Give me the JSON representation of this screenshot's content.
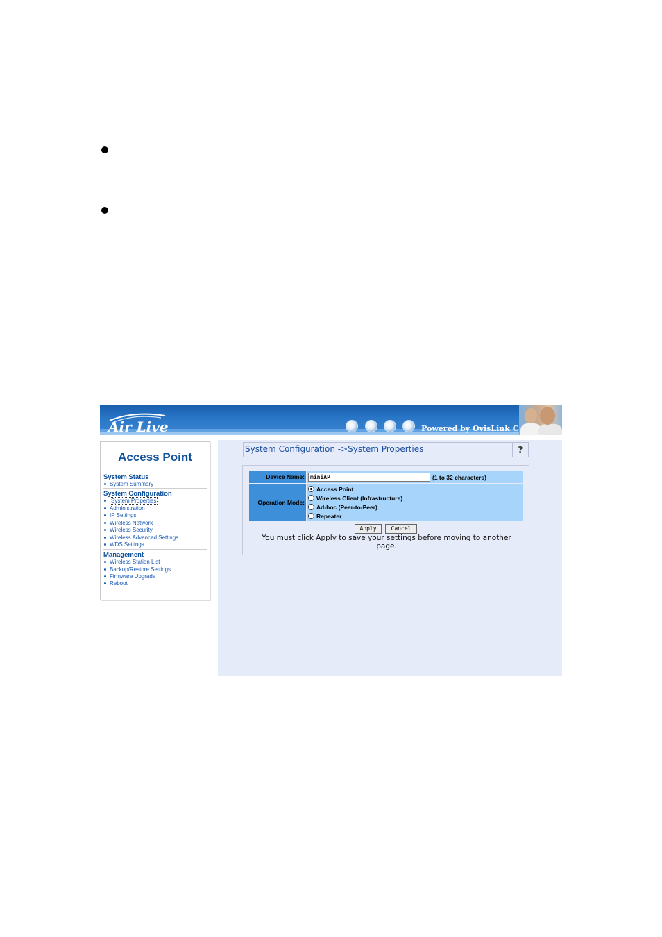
{
  "header": {
    "brand": "Air Live",
    "powered_by": "Powered by OvisLink Corp."
  },
  "nav": {
    "title": "Access Point",
    "sections": [
      {
        "heading": "System Status",
        "items": [
          "System Summary"
        ]
      },
      {
        "heading": "System Configuration",
        "items": [
          "System Properties",
          "Administration",
          "IP Settings",
          "Wireless Network",
          "Wireless Security",
          "Wireless Advanced Settings",
          "WDS Settings"
        ]
      },
      {
        "heading": "Management",
        "items": [
          "Wireless Station List",
          "Backup/Restore Settings",
          "Firmware Upgrade",
          "Reboot"
        ]
      }
    ],
    "active_item": "System Properties"
  },
  "main": {
    "title": "System Configuration ->System Properties",
    "help_label": "?",
    "device_name_label": "Device Name:",
    "device_name_value": "miniAP",
    "device_name_hint": "(1 to 32 characters)",
    "operation_mode_label": "Operation Mode:",
    "operation_modes": [
      "Access Point",
      "Wireless Client (Infrastructure)",
      "Ad-hoc (Peer-to-Peer)",
      "Repeater"
    ],
    "selected_mode": "Access Point",
    "apply_label": "Apply",
    "cancel_label": "Cancel",
    "note": "You must click Apply to save your settings before moving to another page."
  },
  "colors": {
    "header_blue": "#1a5fae",
    "nav_text": "#0d4f9a",
    "content_bg": "#e6ebfa",
    "label_bg": "#3d8fd9",
    "value_bg": "#a6d4fa"
  }
}
